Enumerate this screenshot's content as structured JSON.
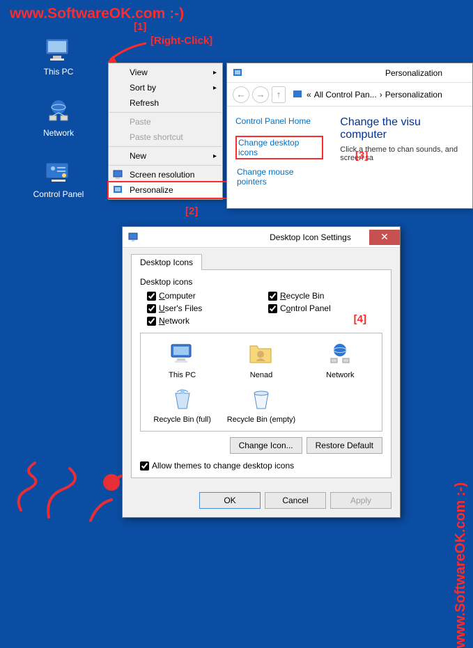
{
  "watermark_top": "www.SoftwareOK.com :-)",
  "watermark_side": "www.SoftwareOK.com :-)",
  "annotations": {
    "n1": "[1]",
    "rclick": "[Right-Click]",
    "n2": "[2]",
    "n3": "[3]",
    "n4": "[4]"
  },
  "desktop": {
    "this_pc": "This PC",
    "network": "Network",
    "control_panel": "Control Panel"
  },
  "context_menu": {
    "view": "View",
    "sort_by": "Sort by",
    "refresh": "Refresh",
    "paste": "Paste",
    "paste_shortcut": "Paste shortcut",
    "new": "New",
    "screen_resolution": "Screen resolution",
    "personalize": "Personalize"
  },
  "pers": {
    "title": "Personalization",
    "breadcrumb_a": "All Control Pan...",
    "breadcrumb_b": "Personalization",
    "home": "Control Panel Home",
    "change_icons": "Change desktop icons",
    "change_mouse": "Change mouse pointers",
    "heading": "Change the visuals and sounds on your computer",
    "heading_vis": "Change the visu   computer",
    "desc": "Click a theme to change the desktop background, color, sounds, and screen saver all at once.",
    "desc_vis": "Click a theme to chan sounds, and screen sa"
  },
  "dlg": {
    "title": "Desktop Icon Settings",
    "tab": "Desktop Icons",
    "group": "Desktop icons",
    "computer": "Computer",
    "users_files": "User's Files",
    "network": "Network",
    "recycle_bin": "Recycle Bin",
    "control_panel": "Control Panel",
    "preview": {
      "this_pc": "This PC",
      "user": "Nenad",
      "network": "Network",
      "rb_full": "Recycle Bin (full)",
      "rb_empty": "Recycle Bin (empty)"
    },
    "change_icon": "Change Icon...",
    "restore_default": "Restore Default",
    "allow_themes": "Allow themes to change desktop icons",
    "ok": "OK",
    "cancel": "Cancel",
    "apply": "Apply"
  }
}
